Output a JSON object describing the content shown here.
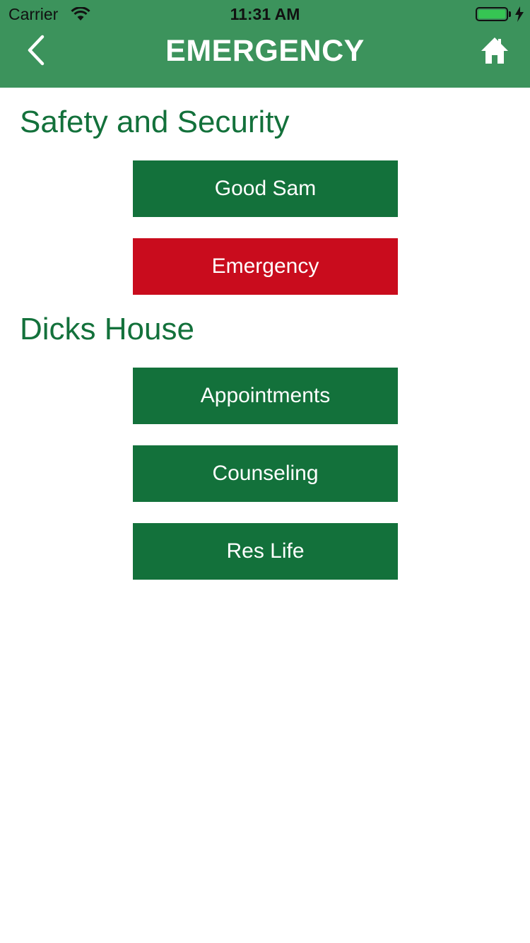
{
  "status_bar": {
    "carrier": "Carrier",
    "time": "11:31 AM"
  },
  "header": {
    "title": "EMERGENCY",
    "back_icon": "chevron-left-icon",
    "home_icon": "home-icon"
  },
  "sections": [
    {
      "heading": "Safety and Security",
      "buttons": [
        {
          "label": "Good Sam"
        },
        {
          "label": "Emergency"
        }
      ]
    },
    {
      "heading": "Dicks House",
      "buttons": [
        {
          "label": "Appointments"
        },
        {
          "label": "Counseling"
        },
        {
          "label": "Res Life"
        }
      ]
    }
  ],
  "colors": {
    "header_bg": "#3c935c",
    "primary_green": "#13713b",
    "emergency_red": "#c90c1d",
    "battery_green": "#36c553"
  }
}
